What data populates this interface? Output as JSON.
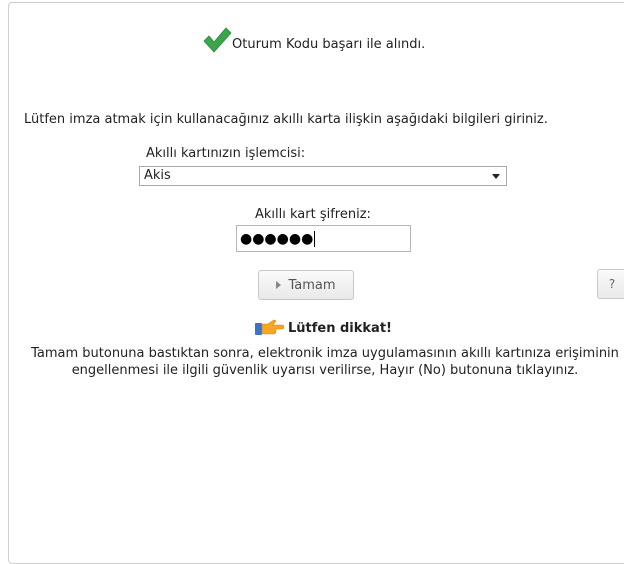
{
  "status": {
    "success_message": "Oturum Kodu başarı ile alındı."
  },
  "form": {
    "instruction": "Lütfen imza atmak için kullanacağınız akıllı karta ilişkin aşağıdaki bilgileri giriniz.",
    "processor_label": "Akıllı kartınızın işlemcisi:",
    "processor_value": "Akis",
    "password_label": "Akıllı kart şifreniz:",
    "password_mask": "●●●●●●",
    "ok_button_label": "Tamam",
    "help_button_label": "?"
  },
  "notice": {
    "title": "Lütfen dikkat!",
    "body": "Tamam butonuna bastıktan sonra, elektronik imza uygulamasının akıllı kartınıza erişiminin engellenmesi ile ilgili güvenlik uyarısı verilirse, Hayır (No) butonuna tıklayınız."
  },
  "colors": {
    "check_green": "#3aa54a",
    "hand_orange": "#f5a623",
    "cuff_blue": "#3b74c4"
  }
}
